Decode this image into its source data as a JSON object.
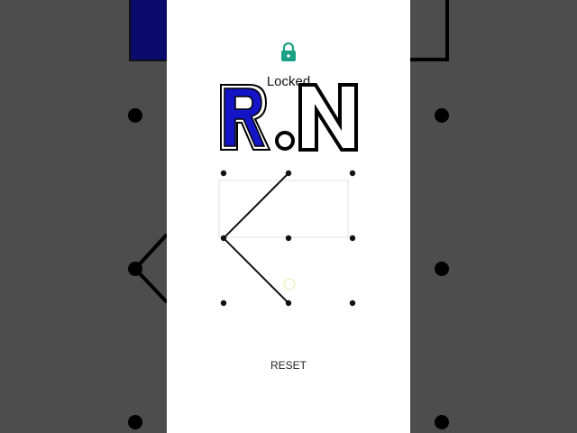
{
  "lock": {
    "icon": "lock-icon",
    "color": "#1aa084",
    "status": "Locked"
  },
  "watermark": {
    "text": "R.N",
    "accent": "#1515c8"
  },
  "pattern": {
    "grid": "3x3",
    "selected_path": [
      1,
      3,
      7
    ],
    "line_color": "#111111",
    "dot_color": "#111111"
  },
  "reset": {
    "label": "RESET"
  }
}
